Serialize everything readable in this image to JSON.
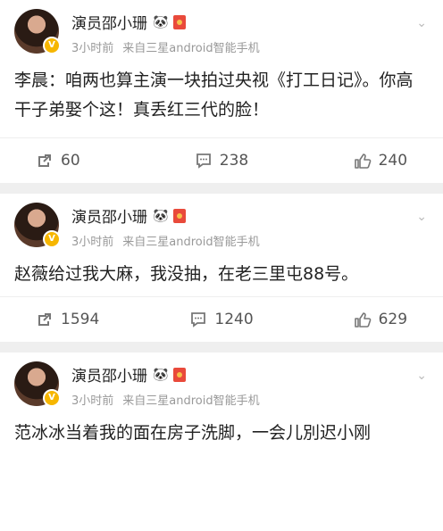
{
  "posts": [
    {
      "username": "演员邵小珊",
      "time": "3小时前",
      "source": "来自三星android智能手机",
      "text": "李晨：咱两也算主演一块拍过央视《打工日记》。你高干子弟娶个这！真丢红三代的脸！",
      "reposts": "60",
      "comments": "238",
      "likes": "240"
    },
    {
      "username": "演员邵小珊",
      "time": "3小时前",
      "source": "来自三星android智能手机",
      "text": "赵薇给过我大麻，我没抽，在老三里屯88号。",
      "reposts": "1594",
      "comments": "1240",
      "likes": "629"
    },
    {
      "username": "演员邵小珊",
      "time": "3小时前",
      "source": "来自三星android智能手机",
      "text": "范冰冰当着我的面在房子洗脚，一会儿別迟小刚"
    }
  ],
  "icons": {
    "panda": "🐼",
    "chevron": "⌄",
    "verified": "V"
  },
  "colors": {
    "background": "#efefef",
    "card": "#ffffff",
    "muted": "#999999",
    "badge": "#f6b600"
  }
}
